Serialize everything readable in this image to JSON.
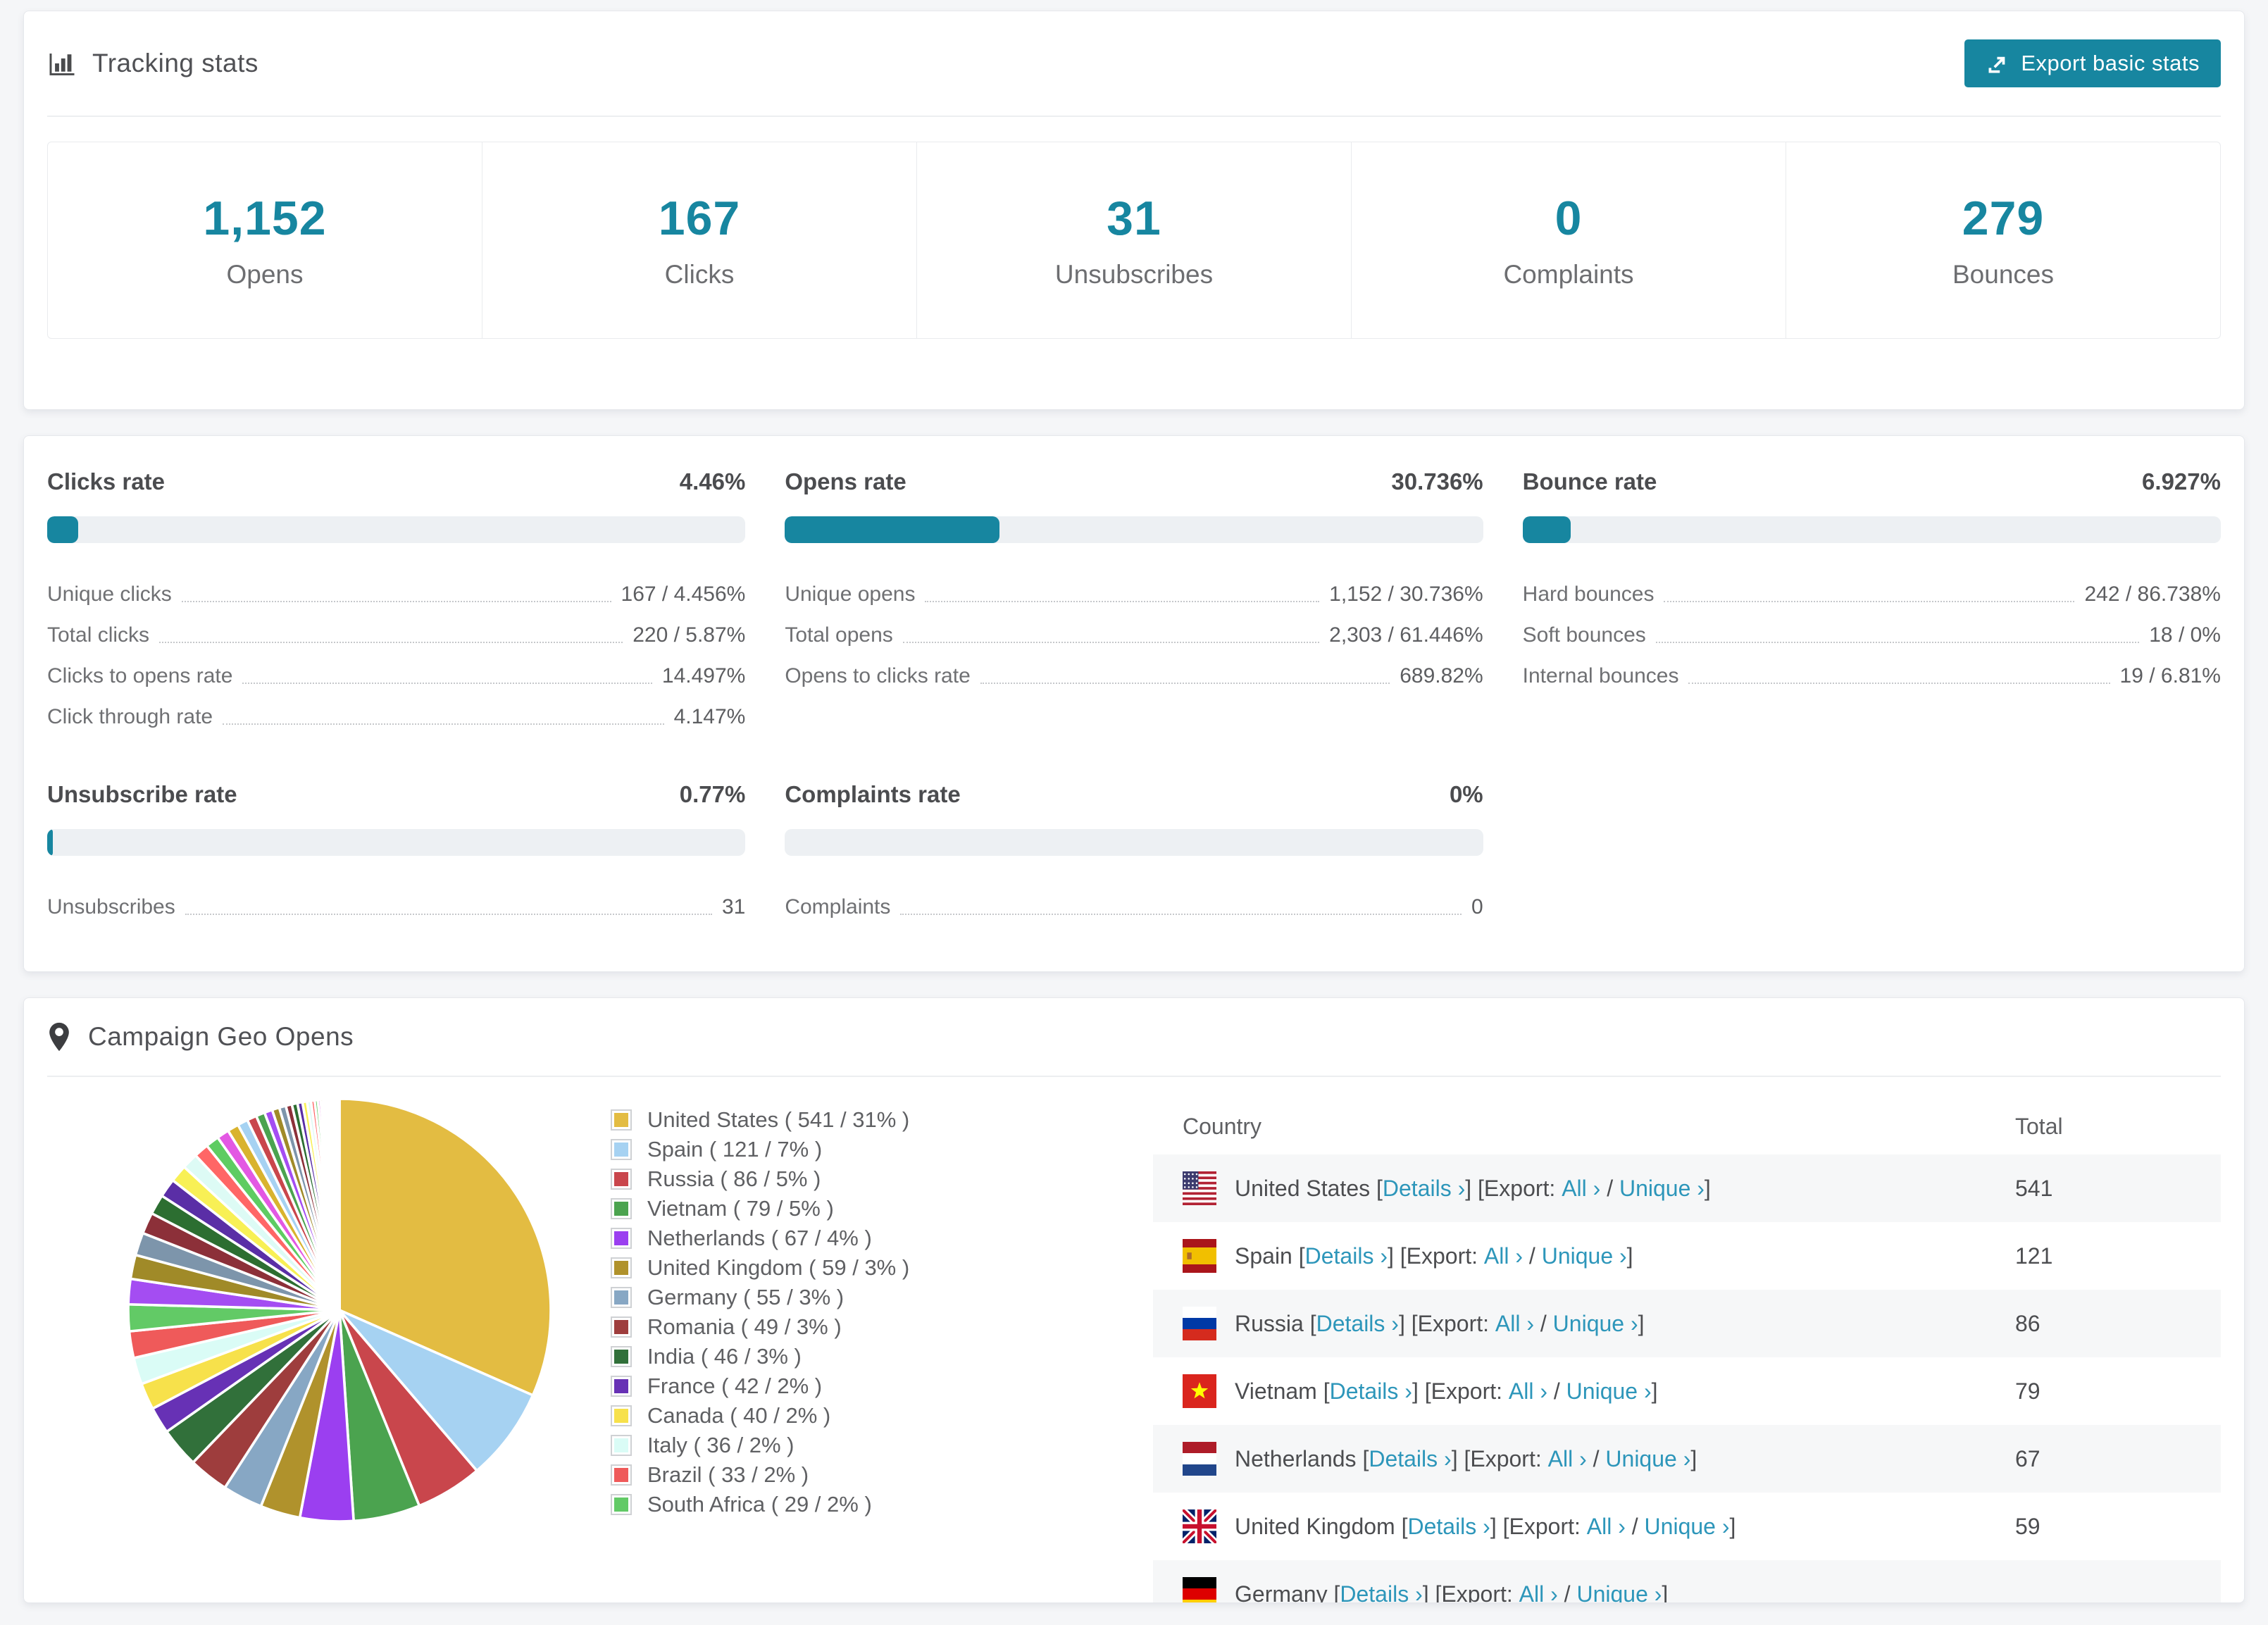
{
  "colors": {
    "accent": "#1786a0",
    "link": "#2d96ba",
    "bar_track": "#edf0f3",
    "page_bg": "#f5f6f8"
  },
  "header": {
    "title": "Tracking stats",
    "export_button": "Export basic stats"
  },
  "summary_stats": [
    {
      "value": "1,152",
      "label": "Opens"
    },
    {
      "value": "167",
      "label": "Clicks"
    },
    {
      "value": "31",
      "label": "Unsubscribes"
    },
    {
      "value": "0",
      "label": "Complaints"
    },
    {
      "value": "279",
      "label": "Bounces"
    }
  ],
  "rates": [
    {
      "title": "Clicks rate",
      "value": "4.46%",
      "percent": 4.46,
      "rows": [
        {
          "label": "Unique clicks",
          "value": "167 / 4.456%"
        },
        {
          "label": "Total clicks",
          "value": "220 / 5.87%"
        },
        {
          "label": "Clicks to opens rate",
          "value": "14.497%"
        },
        {
          "label": "Click through rate",
          "value": "4.147%"
        }
      ]
    },
    {
      "title": "Opens rate",
      "value": "30.736%",
      "percent": 30.736,
      "rows": [
        {
          "label": "Unique opens",
          "value": "1,152 / 30.736%"
        },
        {
          "label": "Total opens",
          "value": "2,303 / 61.446%"
        },
        {
          "label": "Opens to clicks rate",
          "value": "689.82%"
        }
      ]
    },
    {
      "title": "Bounce rate",
      "value": "6.927%",
      "percent": 6.927,
      "rows": [
        {
          "label": "Hard bounces",
          "value": "242 / 86.738%"
        },
        {
          "label": "Soft bounces",
          "value": "18 / 0%"
        },
        {
          "label": "Internal bounces",
          "value": "19 / 6.81%"
        }
      ]
    },
    {
      "title": "Unsubscribe rate",
      "value": "0.77%",
      "percent": 0.77,
      "rows": [
        {
          "label": "Unsubscribes",
          "value": "31"
        }
      ]
    },
    {
      "title": "Complaints rate",
      "value": "0%",
      "percent": 0,
      "rows": [
        {
          "label": "Complaints",
          "value": "0"
        }
      ]
    }
  ],
  "geo": {
    "title": "Campaign Geo Opens",
    "links": {
      "details": "Details ›",
      "export": "Export:",
      "all": "All ›",
      "unique": "Unique ›"
    },
    "table": {
      "columns": [
        "Country",
        "Total"
      ],
      "rows": [
        {
          "country": "United States",
          "flag": "us",
          "total": "541"
        },
        {
          "country": "Spain",
          "flag": "es",
          "total": "121"
        },
        {
          "country": "Russia",
          "flag": "ru",
          "total": "86"
        },
        {
          "country": "Vietnam",
          "flag": "vn",
          "total": "79"
        },
        {
          "country": "Netherlands",
          "flag": "nl",
          "total": "67"
        },
        {
          "country": "United Kingdom",
          "flag": "gb",
          "total": "59"
        },
        {
          "country": "Germany",
          "flag": "de",
          "total": ""
        }
      ]
    }
  },
  "chart_data": {
    "type": "pie",
    "title": "Campaign Geo Opens",
    "unit": "opens",
    "legend_position": "right",
    "start_angle": "12 o'clock, clockwise",
    "series": [
      {
        "name": "United States",
        "value": 541,
        "pct": 31,
        "color": "#e3bc42",
        "legend_label": "United States ( 541 / 31% )"
      },
      {
        "name": "Spain",
        "value": 121,
        "pct": 7,
        "color": "#a6d2f2",
        "legend_label": "Spain ( 121 / 7% )"
      },
      {
        "name": "Russia",
        "value": 86,
        "pct": 5,
        "color": "#c9464c",
        "legend_label": "Russia ( 86 / 5% )"
      },
      {
        "name": "Vietnam",
        "value": 79,
        "pct": 5,
        "color": "#4ba34f",
        "legend_label": "Vietnam ( 79 / 5% )"
      },
      {
        "name": "Netherlands",
        "value": 67,
        "pct": 4,
        "color": "#9b3ff0",
        "legend_label": "Netherlands ( 67 / 4% )"
      },
      {
        "name": "United Kingdom",
        "value": 59,
        "pct": 3,
        "color": "#b0922c",
        "legend_label": "United Kingdom ( 59 / 3% )"
      },
      {
        "name": "Germany",
        "value": 55,
        "pct": 3,
        "color": "#87a7c4",
        "legend_label": "Germany ( 55 / 3% )"
      },
      {
        "name": "Romania",
        "value": 49,
        "pct": 3,
        "color": "#9e3d3d",
        "legend_label": "Romania ( 49 / 3% )"
      },
      {
        "name": "India",
        "value": 46,
        "pct": 3,
        "color": "#31703a",
        "legend_label": "India ( 46 / 3% )"
      },
      {
        "name": "France",
        "value": 42,
        "pct": 2,
        "color": "#6731b5",
        "legend_label": "France ( 42 / 2% )"
      },
      {
        "name": "Canada",
        "value": 40,
        "pct": 2,
        "color": "#f7e14b",
        "legend_label": "Canada ( 40 / 2% )"
      },
      {
        "name": "Italy",
        "value": 36,
        "pct": 2,
        "color": "#dafcf6",
        "legend_label": "Italy ( 36 / 2% )"
      },
      {
        "name": "Brazil",
        "value": 33,
        "pct": 2,
        "color": "#ef5a5a",
        "legend_label": "Brazil ( 33 / 2% )"
      },
      {
        "name": "South Africa",
        "value": 29,
        "pct": 2,
        "color": "#62ca66",
        "legend_label": "South Africa ( 29 / 2% )"
      }
    ],
    "other": {
      "note": "unlabeled long tail of smaller countries, slices shrink toward 12 o'clock",
      "pct_total": 26,
      "values": [
        1.9,
        1.8,
        1.7,
        1.6,
        1.5,
        1.4,
        1.3,
        1.2,
        1.1,
        1.0,
        0.92,
        0.85,
        0.78,
        0.72,
        0.66,
        0.6,
        0.55,
        0.5,
        0.46,
        0.42,
        0.38,
        0.34,
        0.3,
        0.27,
        0.24,
        0.21,
        0.19,
        0.17,
        0.15,
        0.13,
        0.11,
        0.1,
        0.09,
        0.08,
        0.07,
        0.06,
        0.05,
        0.045,
        0.04,
        0.035,
        0.03,
        0.025,
        0.02
      ],
      "palette": [
        "#a44df2",
        "#a08a28",
        "#7d95ab",
        "#8c3039",
        "#2c6e31",
        "#5a2ea6",
        "#f8f055",
        "#ddfbf5",
        "#ff6666",
        "#5ecc62",
        "#e358e3",
        "#d9b32e",
        "#a6d2f2",
        "#c9464c",
        "#4ba34f"
      ]
    }
  }
}
